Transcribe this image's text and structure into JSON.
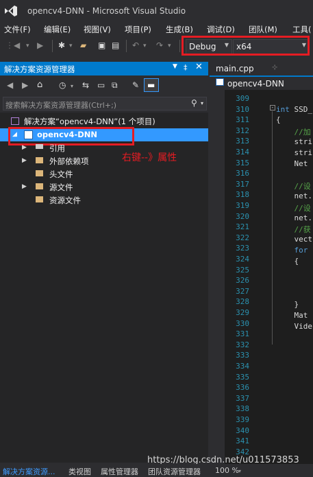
{
  "window": {
    "title": "opencv4-DNN - Microsoft Visual Studio"
  },
  "menu": [
    "文件(F)",
    "编辑(E)",
    "视图(V)",
    "项目(P)",
    "生成(B)",
    "调试(D)",
    "团队(M)",
    "工具("
  ],
  "toolbar": {
    "configuration": "Debug",
    "platform": "x64"
  },
  "solution_explorer": {
    "title": "解决方案资源管理器",
    "search_placeholder": "搜索解决方案资源管理器(Ctrl+;)",
    "solution_label": "解决方案“opencv4-DNN”(1 个项目)",
    "project_label": "opencv4-DNN",
    "items": [
      "引用",
      "外部依赖项",
      "头文件",
      "源文件",
      "资源文件"
    ]
  },
  "annotation": "右键--》属性",
  "editor": {
    "tab_label": "main.cpp",
    "nav_label": "opencv4-DNN",
    "line_numbers": [
      "309",
      "310",
      "311",
      "312",
      "313",
      "314",
      "315",
      "316",
      "317",
      "318",
      "319",
      "320",
      "321",
      "322",
      "323",
      "324",
      "325",
      "326",
      "327",
      "328",
      "329",
      "330",
      "331",
      "332",
      "333",
      "334",
      "335",
      "336",
      "337",
      "338",
      "339",
      "340",
      "341",
      "342"
    ],
    "code": {
      "l310_kw": "int",
      "l310_txt": " SSD_",
      "l311": "{",
      "l312": "    //加",
      "l313": "    stri",
      "l314": "    stri",
      "l315": "    Net ",
      "l317": "    //设",
      "l318": "    net.",
      "l319": "    //设",
      "l320": "    net.",
      "l321": "    //获",
      "l322": "    vect",
      "l323": "    for ",
      "l324": "    {",
      "l328": "    }",
      "l329": "    Mat ",
      "l330": "    Vide"
    }
  },
  "statusbar": {
    "tabs": [
      "解决方案资源...",
      "类视图",
      "属性管理器",
      "团队资源管理器"
    ],
    "zoom": "100 %"
  },
  "watermark": "https://blog.csdn.net/u011573853",
  "colors": {
    "accent": "#007acc",
    "highlight_box": "#e51c23",
    "selection": "#3399ff"
  }
}
